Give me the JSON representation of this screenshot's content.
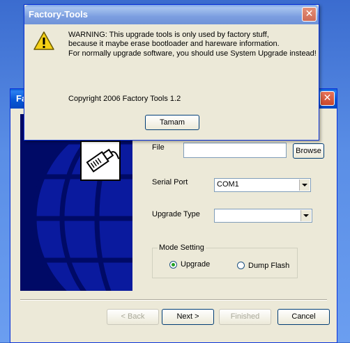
{
  "wizard": {
    "title": "Fa",
    "close_glyph": "✕",
    "form": {
      "file_label": "File",
      "file_value": "",
      "browse_label": "Browse",
      "serial_port_label": "Serial Port",
      "serial_port_value": "COM1",
      "upgrade_type_label": "Upgrade Type",
      "upgrade_type_value": "",
      "mode_setting_title": "Mode Setting",
      "mode_options": [
        {
          "label": "Upgrade",
          "selected": true
        },
        {
          "label": "Dump Flash",
          "selected": false
        }
      ]
    },
    "buttons": {
      "back": "< Back",
      "next": "Next >",
      "finished": "Finished",
      "cancel": "Cancel"
    }
  },
  "dialog": {
    "title": "Factory-Tools",
    "close_glyph": "✕",
    "icon": "warning-icon",
    "lines": [
      "WARNING: This upgrade tools is only used by factory stuff,",
      "because it maybe erase bootloader and hareware information.",
      "For normally upgrade software, you should use System Upgrade instead!"
    ],
    "copyright": "Copyright 2006 Factory Tools 1.2",
    "ok_label": "Tamam"
  },
  "colors": {
    "desktop": "#5a8ee6",
    "titlebar_active": "#0758d6",
    "titlebar_dialog": "#7c9ee0",
    "wizard_image_bg": "#000a66",
    "warning_yellow": "#f5d016"
  }
}
